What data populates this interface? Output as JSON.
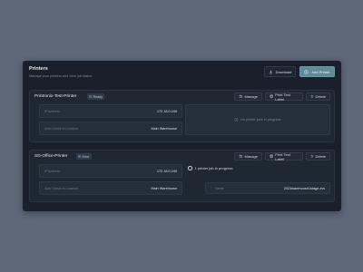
{
  "header": {
    "title": "Printers",
    "subtitle": "Manage your printers and view job status",
    "download_label": "Download",
    "add_label": "Add Printer"
  },
  "actions": {
    "manage": "Manage",
    "print_test": "Print Test Label",
    "delete": "Delete"
  },
  "printers": [
    {
      "name": "Printronix-Test-Printer",
      "status": "Ready",
      "ip_label": "IP Address",
      "ip": "172.18.0.249",
      "location_label": "Auto Check In Location",
      "location": "Main Warehouse",
      "jobs_text": "No printer jobs in progress"
    },
    {
      "name": "SD-Office-Printer",
      "status": "Error",
      "ip_label": "IP Address",
      "ip": "172.18.0.249",
      "location_label": "Auto Check In Location",
      "location": "Main Warehouse",
      "jobs_text": "1 printer job in progress",
      "job_name_label": "Name",
      "job_name": "2023warehouse1stage.zvs"
    }
  ]
}
